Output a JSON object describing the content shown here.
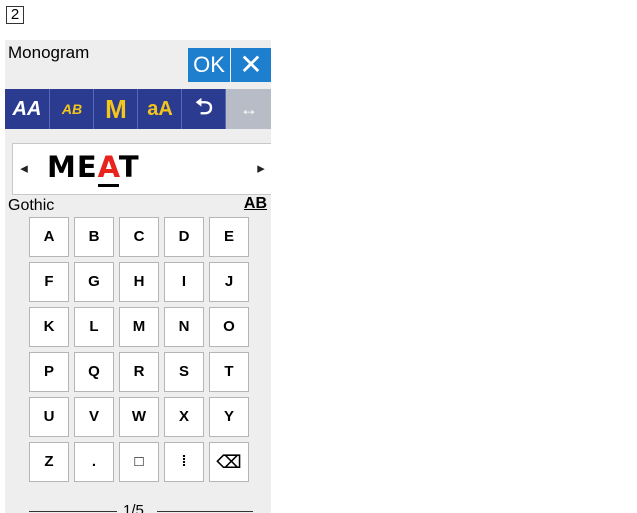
{
  "step": {
    "number": "2"
  },
  "window": {
    "title": "Monogram",
    "ok_label": "OK",
    "close_glyph": "✕"
  },
  "toolbar": {
    "items": [
      {
        "name": "font-style-icon",
        "glyph": "AA"
      },
      {
        "name": "text-size-icon",
        "glyph": "AB"
      },
      {
        "name": "monogram-size-icon",
        "glyph": "M"
      },
      {
        "name": "letter-case-icon",
        "glyph": "aA"
      },
      {
        "name": "mirror-icon",
        "glyph": "⮌"
      },
      {
        "name": "spacing-icon",
        "glyph": "↔"
      }
    ]
  },
  "text_input": {
    "left_arrow": "◂",
    "right_arrow": "▸",
    "before_cursor": "ME",
    "cursor_char": "A",
    "after_cursor": "T"
  },
  "font": {
    "name": "Gothic",
    "icon_label": "AB"
  },
  "keyboard": {
    "rows": [
      [
        "A",
        "B",
        "C",
        "D",
        "E"
      ],
      [
        "F",
        "G",
        "H",
        "I",
        "J"
      ],
      [
        "K",
        "L",
        "M",
        "N",
        "O"
      ],
      [
        "P",
        "Q",
        "R",
        "S",
        "T"
      ],
      [
        "U",
        "V",
        "W",
        "X",
        "Y"
      ],
      [
        "Z",
        ".",
        "□",
        "⁞",
        "⌫"
      ]
    ]
  },
  "pager": {
    "label": "1/5"
  },
  "colors": {
    "accent": "#1f7fcf",
    "toolbar": "#2b3b8f",
    "cursor_char": "#e8231e",
    "icon_yellow": "#f4c51a"
  }
}
